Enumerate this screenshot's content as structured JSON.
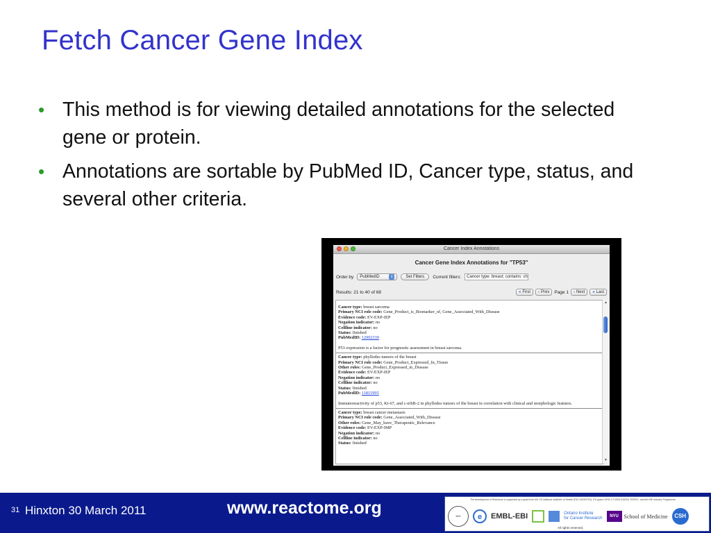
{
  "slide": {
    "title": "Fetch Cancer Gene Index",
    "bullets": [
      "This method is for viewing detailed annotations for the selected gene or protein.",
      "Annotations are sortable by PubMed ID, Cancer type, status, and several other criteria."
    ]
  },
  "window": {
    "title": "Cancer Index Annotations",
    "heading": "Cancer Gene Index Annotations for \"TP53\"",
    "order_by_label": "Order by",
    "order_by_value": "PubMedID",
    "set_filters_label": "Set Filters",
    "current_filters_label": "Current filters:",
    "current_filters_value": "Cancer type: breast; contains: checked",
    "results_text": "Results: 21 to 40 of 68",
    "pager": {
      "first": "First",
      "prev": "Prev",
      "page": "Page 1",
      "next": "Next",
      "last": "Last"
    },
    "entries": [
      {
        "rows": [
          {
            "label": "Cancer type:",
            "value": "breast sarcoma"
          },
          {
            "label": "Primary NCI role code:",
            "value": "Gene_Product_is_Biomarker_of, Gene_Associated_With_Disease"
          },
          {
            "label": "Evidence code:",
            "value": "EV-EXP-IEP"
          },
          {
            "label": "Negation indicator:",
            "value": "no"
          },
          {
            "label": "Cellline indicator:",
            "value": "no"
          },
          {
            "label": "Status:",
            "value": "finished"
          }
        ],
        "pubmed_label": "PubMedID:",
        "pubmed_id": "12002339",
        "summary": "P53 expression is a factor for prognostic assessment in breast sarcoma."
      },
      {
        "rows": [
          {
            "label": "Cancer type:",
            "value": "phyllodes tumors of the breast"
          },
          {
            "label": "Primary NCI role code:",
            "value": "Gene_Product_Expressed_In_Tissue"
          },
          {
            "label": "Other roles:",
            "value": "Gene_Product_Expressed_in_Disease"
          },
          {
            "label": "Evidence code:",
            "value": "EV-EXP-IEP"
          },
          {
            "label": "Negation indicator:",
            "value": "no"
          },
          {
            "label": "Cellline indicator:",
            "value": "no"
          },
          {
            "label": "Status:",
            "value": "finished"
          }
        ],
        "pubmed_label": "PubMedID:",
        "pubmed_id": "11815995",
        "summary": "Immunoreactivity of p53, Ki-67, and c-erbB-2 in phyllodes tumors of the breast in correlation with clinical and morphologic features."
      },
      {
        "rows": [
          {
            "label": "Cancer type:",
            "value": "breast cancer metastasis"
          },
          {
            "label": "Primary NCI role code:",
            "value": "Gene_Associated_With_Disease"
          },
          {
            "label": "Other roles:",
            "value": "Gene_May_have_Therapeutic_Relevance"
          },
          {
            "label": "Evidence code:",
            "value": "EV-EXP-IMP"
          },
          {
            "label": "Negation indicator:",
            "value": "no"
          },
          {
            "label": "Cellline indicator:",
            "value": "no"
          },
          {
            "label": "Status:",
            "value": "finished"
          }
        ]
      }
    ],
    "colors": {
      "link": "#1a3fd6",
      "scroll_thumb": "#2f62c8"
    }
  },
  "footer": {
    "page_number": "31",
    "venue": "Hinxton 30 March 2011",
    "website": "www.reactome.org",
    "funding_note": "The development of Reactome is supported by a grant from the US National Institutes of Health (P41 HG003751), EU grant LSHG-CT-2005-518254 \"ENFIN\", and the EBI Industry Programme.",
    "logos": {
      "nih": "NIH",
      "e": "e",
      "embl": "EMBL-EBI",
      "oicr_line1": "Ontario Institute",
      "oicr_line2": "for Cancer Research",
      "nyu_badge": "NYU",
      "nyu_text": "School of Medicine",
      "csh": "CSH"
    },
    "rights": "All rights reserved.",
    "colors": {
      "bar": "#0a1a8c",
      "title": "#3333cc",
      "bullet": "#2a9a2a"
    }
  }
}
